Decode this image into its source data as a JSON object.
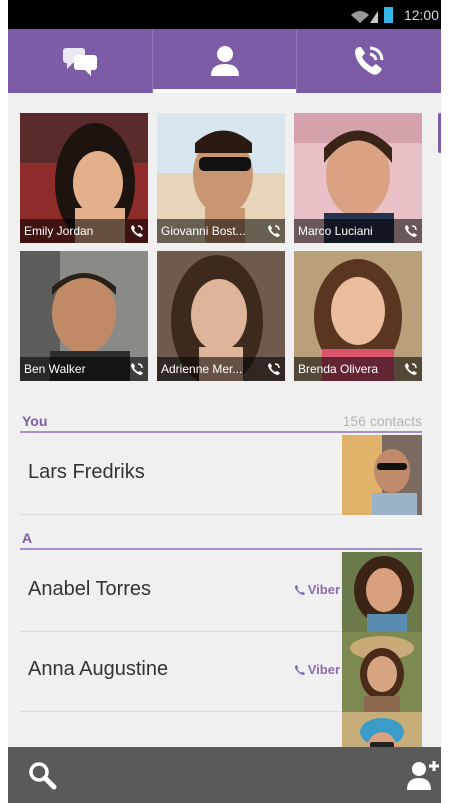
{
  "statusbar": {
    "time": "12:00"
  },
  "tabs": [
    {
      "id": "chats",
      "icon": "chat-bubbles-icon",
      "active": false
    },
    {
      "id": "contacts",
      "icon": "person-icon",
      "active": true
    },
    {
      "id": "calls",
      "icon": "phone-icon",
      "active": false
    }
  ],
  "favorites": [
    {
      "name": "Emily Jordan"
    },
    {
      "name": "Giovanni Bost..."
    },
    {
      "name": "Marco Luciani"
    },
    {
      "name": "Ben Walker"
    },
    {
      "name": "Adrienne Mer..."
    },
    {
      "name": "Brenda Olivera"
    }
  ],
  "you_section": {
    "label": "You",
    "count": "156 contacts",
    "name": "Lars Fredriks"
  },
  "a_section": {
    "label": "A"
  },
  "contacts": [
    {
      "name": "Anabel Torres",
      "badge": "Viber"
    },
    {
      "name": "Anna Augustine",
      "badge": "Viber"
    },
    {
      "name": "",
      "badge": ""
    }
  ],
  "bottombar": {
    "left_icon": "search-icon",
    "right_icon": "add-contact-icon"
  },
  "colors": {
    "accent": "#7d5ca7",
    "bottombar": "#5a5a5a"
  }
}
